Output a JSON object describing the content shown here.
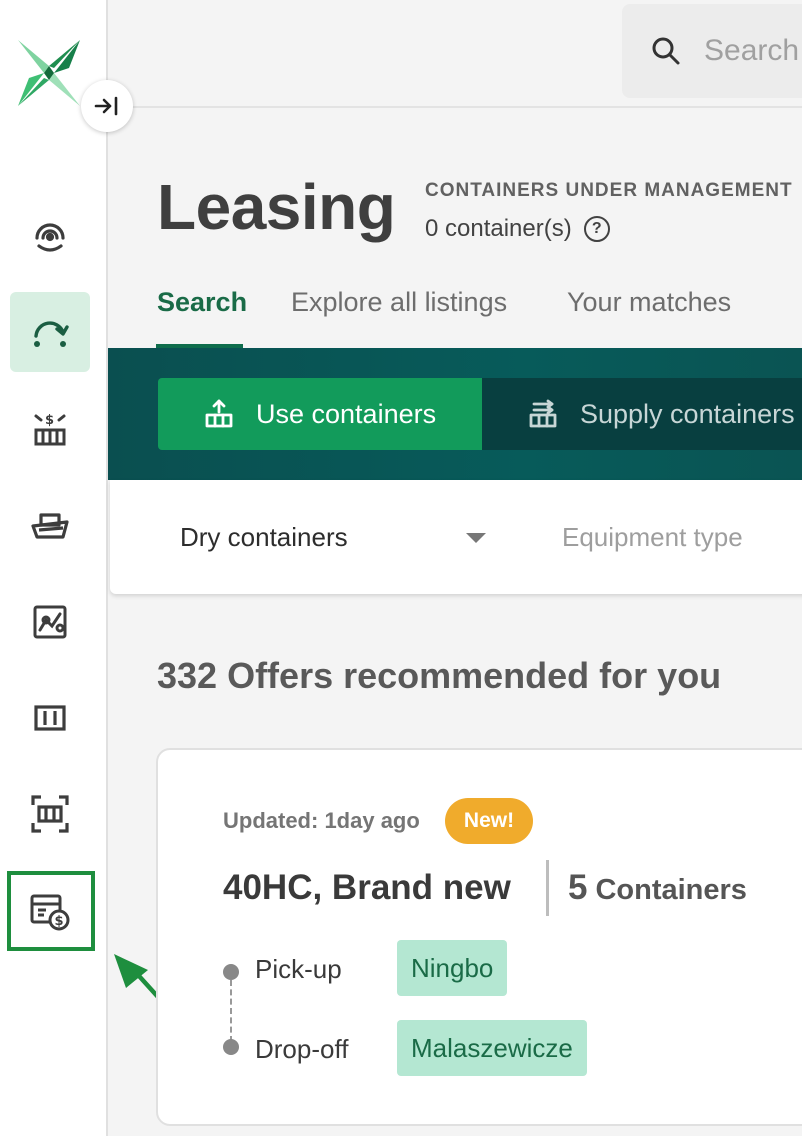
{
  "app": {
    "logo": "x-logo",
    "collapse_icon": "collapse-sidebar-icon"
  },
  "sidebar": {
    "items": [
      {
        "icon": "support-headset-icon",
        "active": false
      },
      {
        "icon": "leasing-arc-arrow-icon",
        "active": true
      },
      {
        "icon": "container-trade-dollar-icon",
        "active": false
      },
      {
        "icon": "ship-icon",
        "active": false
      },
      {
        "icon": "route-map-icon",
        "active": false
      },
      {
        "icon": "container-icon",
        "active": false
      },
      {
        "icon": "container-scan-icon",
        "active": false
      },
      {
        "icon": "billing-dollar-icon",
        "active": false,
        "highlighted": true
      }
    ],
    "highlight_color": "#1e8e3e"
  },
  "search": {
    "placeholder": "Search"
  },
  "header": {
    "title": "Leasing",
    "management_label": "CONTAINERS UNDER MANAGEMENT",
    "container_count": "0 container(s)",
    "help_glyph": "?"
  },
  "tabs": [
    {
      "label": "Search",
      "active": true
    },
    {
      "label": "Explore all listings",
      "active": false
    },
    {
      "label": "Your matches",
      "active": false
    }
  ],
  "mode_toggle": {
    "use_label": "Use containers",
    "supply_label": "Supply containers"
  },
  "filters": {
    "container_type": "Dry containers",
    "equipment_placeholder": "Equipment type"
  },
  "offers": {
    "heading": "332 Offers recommended for you",
    "cards": [
      {
        "updated": "Updated: 1day ago",
        "badge": "New!",
        "title": "40HC, Brand new",
        "count": "5",
        "count_unit": "Containers",
        "pickup_label": "Pick-up",
        "pickup_location": "Ningbo",
        "dropoff_label": "Drop-off",
        "dropoff_location": "Malaszewicze"
      }
    ]
  },
  "colors": {
    "brand_green": "#129b5b",
    "teal": "#075b5a",
    "active_tab": "#1a6b47",
    "chip_bg": "#b4e7d2",
    "badge": "#f0ab2c"
  }
}
